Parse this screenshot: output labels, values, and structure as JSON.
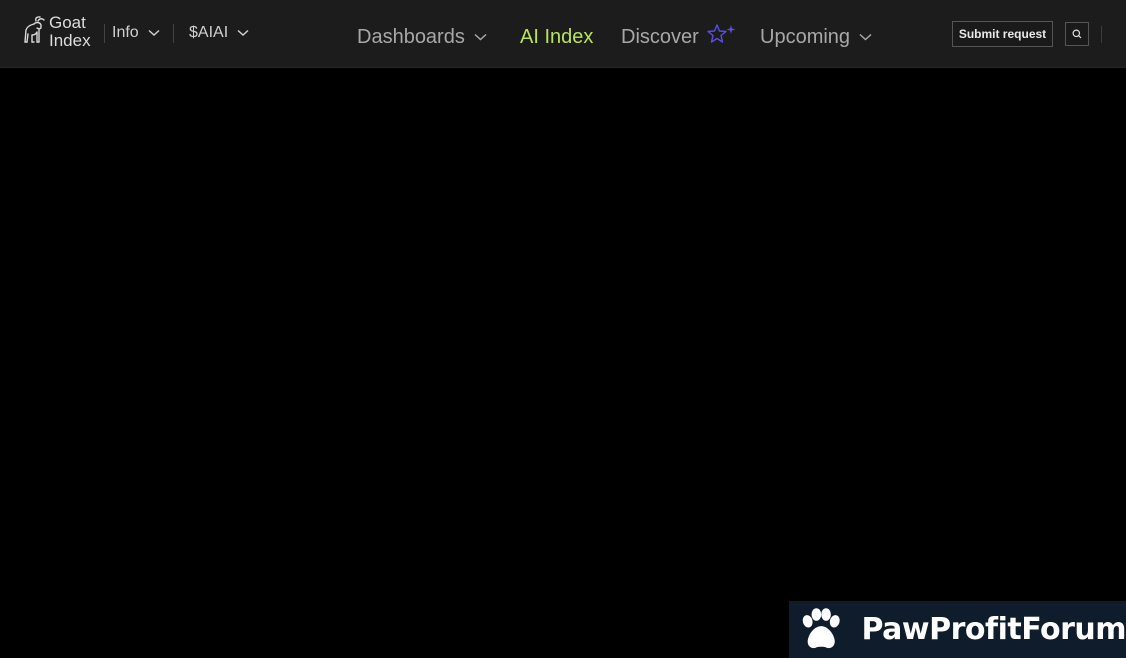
{
  "header": {
    "logo": {
      "line1": "Goat",
      "line2": "Index",
      "icon": "goat-icon"
    },
    "left_menus": [
      {
        "label": "Info",
        "icon": "chevron-down-icon"
      },
      {
        "label": "$AIAI",
        "icon": "chevron-down-icon"
      }
    ],
    "nav": {
      "dashboards": "Dashboards",
      "ai_index": "AI Index",
      "discover": "Discover",
      "upcoming": "Upcoming"
    },
    "submit_label": "Submit request",
    "search_icon": "search-icon"
  },
  "colors": {
    "header_bg": "#1c1c1c",
    "page_bg": "#000000",
    "active_nav": "#b9e35a",
    "star_accent": "#5b4de6",
    "watermark_bg": "#0f1c2b"
  },
  "watermark": {
    "text": "PawProfitForum",
    "icon": "paw-icon"
  }
}
